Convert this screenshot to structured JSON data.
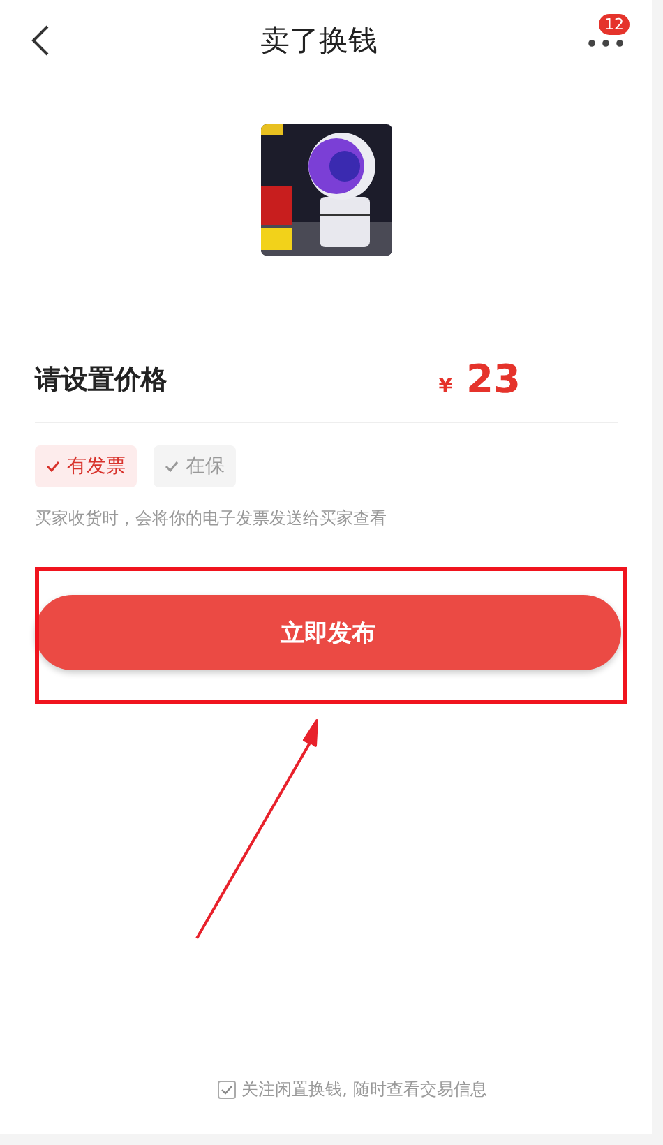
{
  "header": {
    "title": "卖了换钱",
    "badge": "12"
  },
  "price": {
    "label": "请设置价格",
    "currency": "¥",
    "value": "23"
  },
  "tags": [
    {
      "label": "有发票",
      "selected": true
    },
    {
      "label": "在保",
      "selected": false
    }
  ],
  "hint": "买家收货时，会将你的电子发票发送给买家查看",
  "publish_button": "立即发布",
  "follow": {
    "label": "关注闲置换钱, 随时查看交易信息",
    "checked": true
  }
}
